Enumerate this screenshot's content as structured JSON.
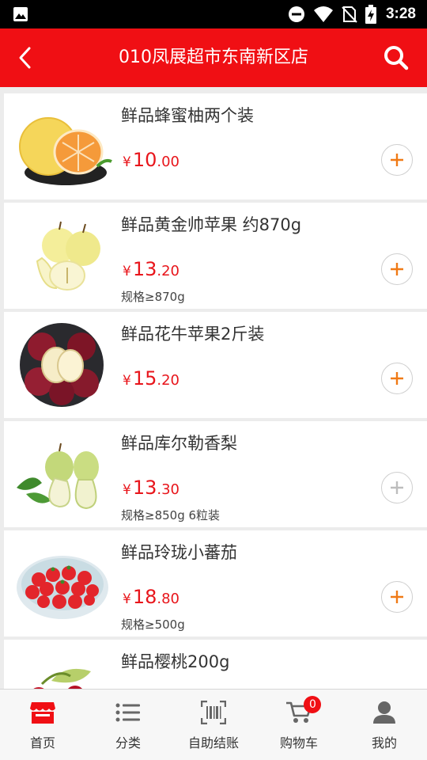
{
  "status_bar": {
    "time": "3:28"
  },
  "header": {
    "title": "010凤展超市东南新区店"
  },
  "products": [
    {
      "name": "鲜品蜂蜜柚两个装",
      "currency": "¥",
      "price_int": "10",
      "price_dec": ".00",
      "spec": "",
      "image": "pomelo"
    },
    {
      "name": "鲜品黄金帅苹果 约870g",
      "currency": "¥",
      "price_int": "13",
      "price_dec": ".20",
      "spec": "规格≥870g",
      "image": "golden-apple"
    },
    {
      "name": "鲜品花牛苹果2斤装",
      "currency": "¥",
      "price_int": "15",
      "price_dec": ".20",
      "spec": "",
      "image": "red-apple"
    },
    {
      "name": "鲜品库尔勒香梨",
      "currency": "¥",
      "price_int": "13",
      "price_dec": ".30",
      "spec": "规格≥850g 6粒装",
      "image": "pear"
    },
    {
      "name": "鲜品玲珑小蕃茄",
      "currency": "¥",
      "price_int": "18",
      "price_dec": ".80",
      "spec": "规格≥500g",
      "image": "cherry-tomato"
    },
    {
      "name": "鲜品樱桃200g",
      "currency": "",
      "price_int": "",
      "price_dec": "",
      "spec": "",
      "image": "cherry"
    }
  ],
  "add_buttons_state": [
    "active",
    "active",
    "active",
    "disabled",
    "active"
  ],
  "tabs": [
    {
      "label": "首页",
      "icon": "store-icon",
      "active": true
    },
    {
      "label": "分类",
      "icon": "list-icon"
    },
    {
      "label": "自助结账",
      "icon": "barcode-icon"
    },
    {
      "label": "购物车",
      "icon": "cart-icon",
      "badge": "0"
    },
    {
      "label": "我的",
      "icon": "user-icon"
    }
  ],
  "colors": {
    "brand": "#f00f14",
    "price": "#e8151b",
    "add_active": "#f07a16",
    "add_disabled": "#bdbdbd",
    "tab_active": "#f00f14",
    "tab_inactive": "#666666"
  }
}
